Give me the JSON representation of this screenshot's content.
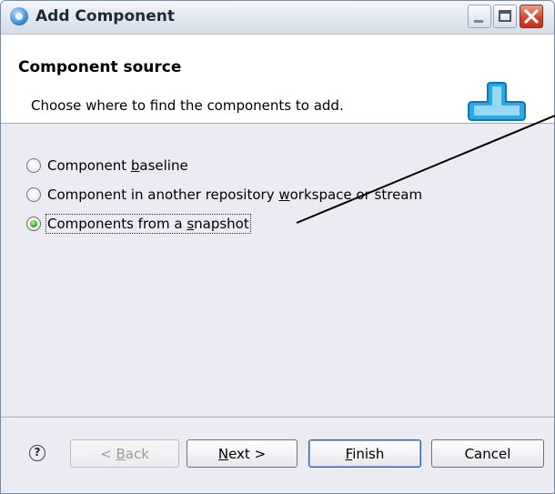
{
  "window": {
    "title": "Add Component",
    "icon": "eclipse-app-icon",
    "controls": {
      "minimize": "minimize-icon",
      "maximize": "maximize-icon",
      "close": "close-icon"
    }
  },
  "header": {
    "title": "Component source",
    "description": "Choose where to find the components to add.",
    "icon": "component-banner-icon"
  },
  "options": [
    {
      "pre": "Component ",
      "mnemonic": "b",
      "post": "aseline",
      "selected": false
    },
    {
      "pre": "Component in another repository ",
      "mnemonic": "w",
      "post": "orkspace or stream",
      "selected": false
    },
    {
      "pre": "Components from a ",
      "mnemonic": "s",
      "post": "napshot",
      "selected": true
    }
  ],
  "footer": {
    "help": "?",
    "back": {
      "pre": "< ",
      "mnemonic": "B",
      "post": "ack",
      "enabled": false
    },
    "next": {
      "pre": "",
      "mnemonic": "N",
      "post": "ext >",
      "enabled": true
    },
    "finish": {
      "pre": "",
      "mnemonic": "F",
      "post": "inish",
      "enabled": true
    },
    "cancel": {
      "label": "Cancel",
      "enabled": true
    }
  },
  "colors": {
    "window_bg": "#ecebf3",
    "header_bg": "#ffffff",
    "radio_selected": "#3fae2a",
    "banner_accent": "#29a9e6"
  }
}
